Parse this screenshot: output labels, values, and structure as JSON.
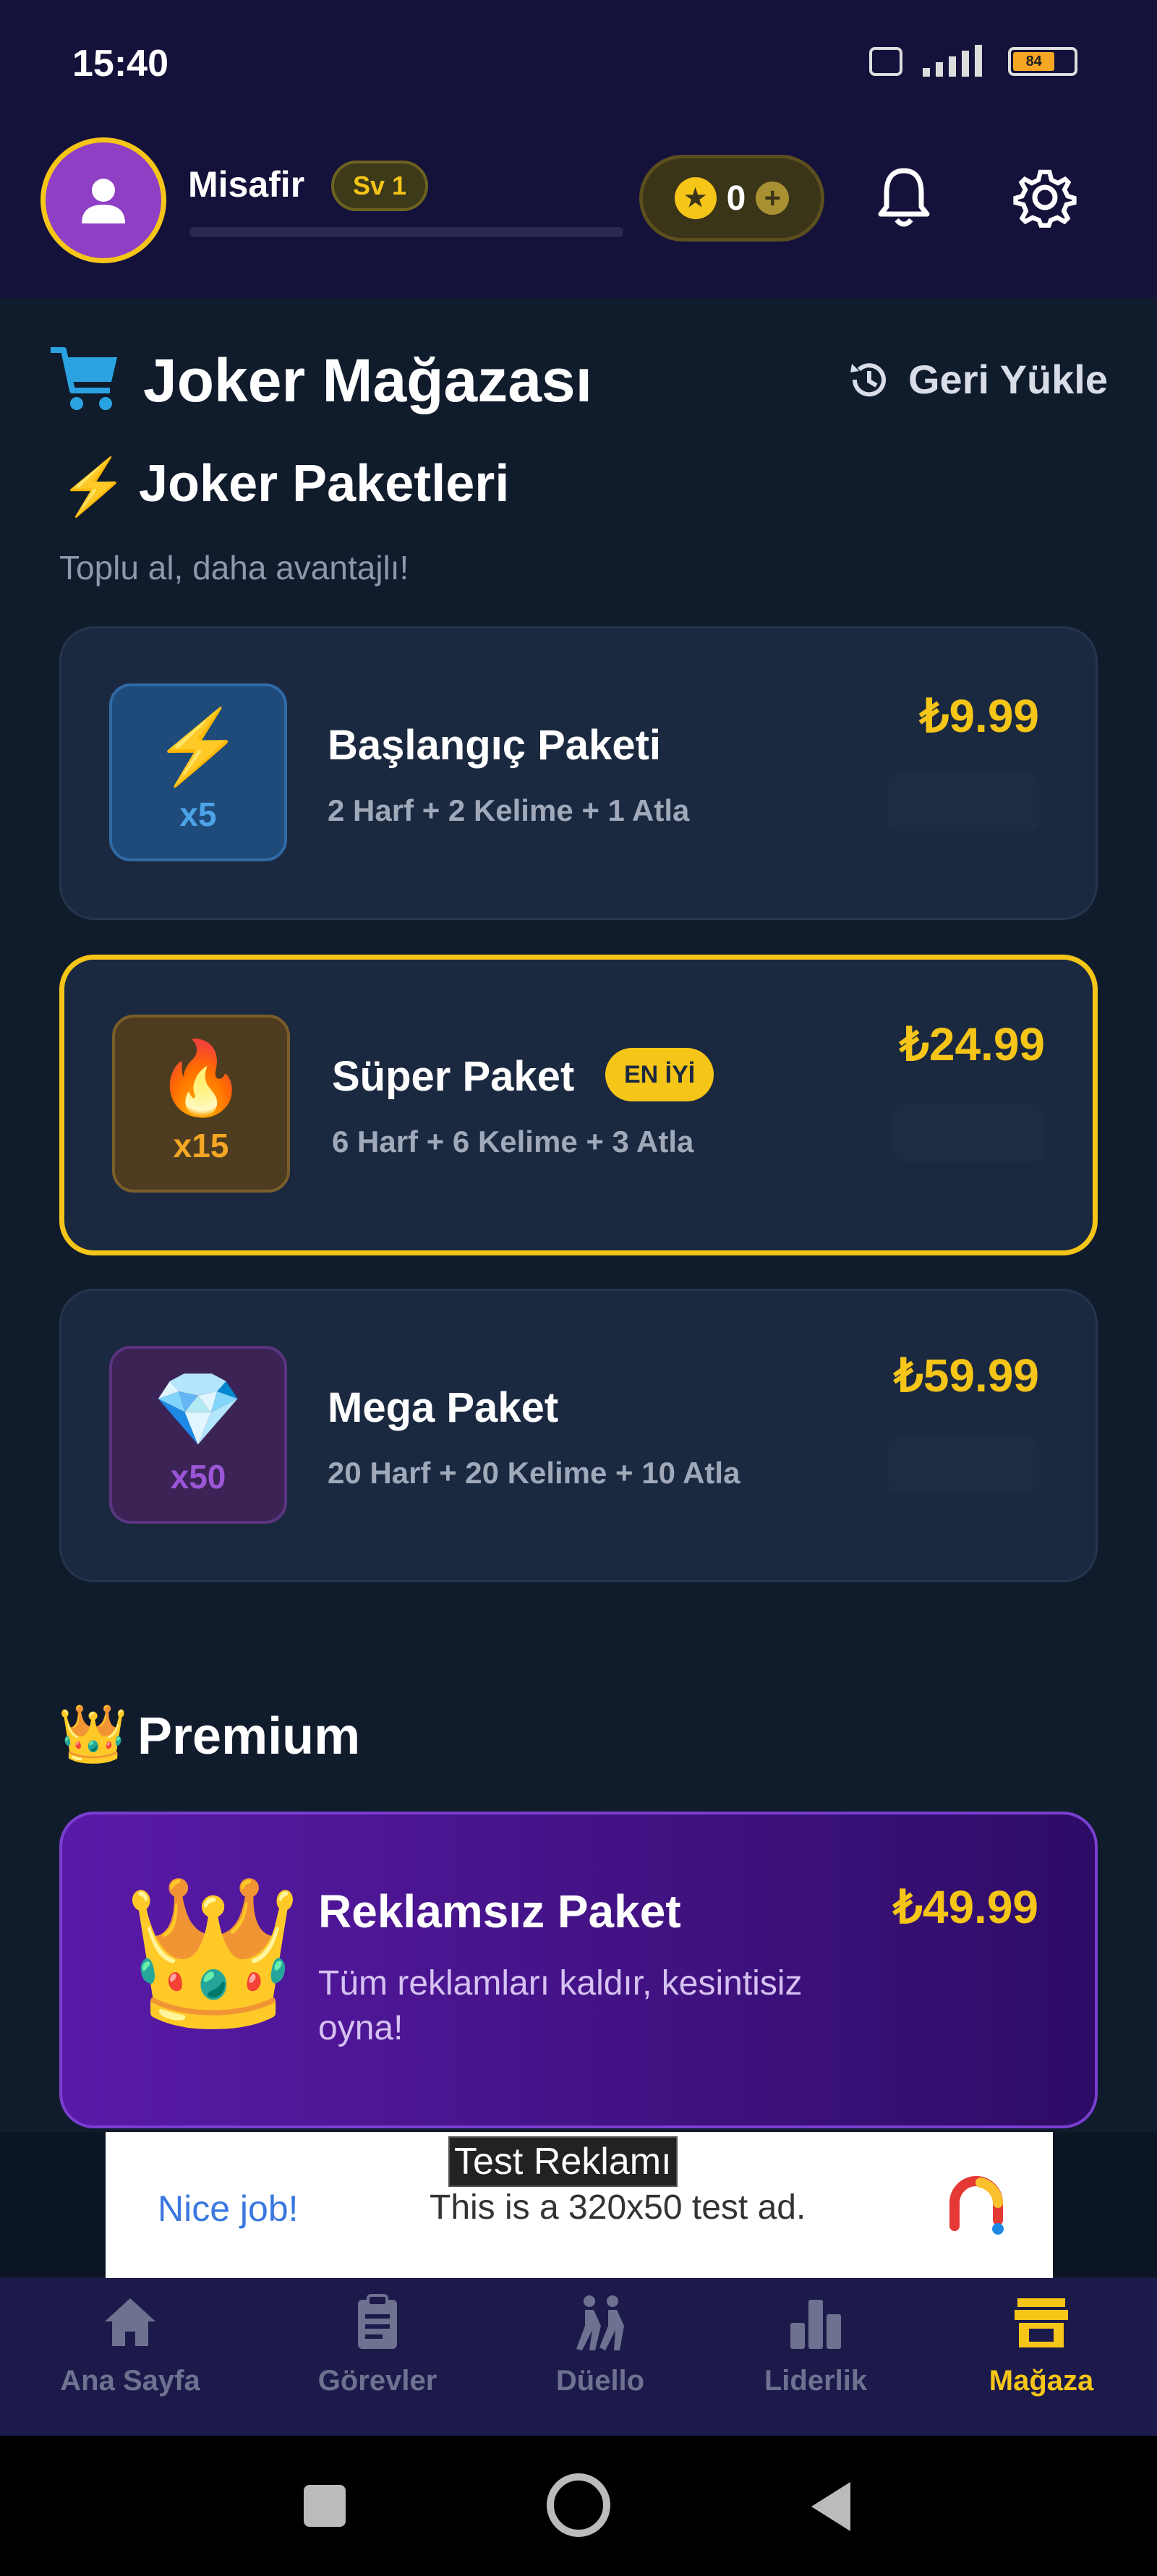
{
  "status_bar": {
    "time": "15:40",
    "battery": "84"
  },
  "header": {
    "username": "Misafir",
    "level": "Sv 1",
    "xp_progress": 0,
    "coins": "0",
    "plus_symbol": "+"
  },
  "store": {
    "title": "Joker Mağazası",
    "restore_label": "Geri Yükle"
  },
  "packs_section": {
    "title": "Joker Paketleri",
    "hint": "Toplu al, daha avantajlı!",
    "packs": [
      {
        "icon": "⚡",
        "multiplier": "x5",
        "name": "Başlangıç Paketi",
        "contents": "2 Harf + 2 Kelime + 1 Atla",
        "price": "₺9.99"
      },
      {
        "icon": "🔥",
        "multiplier": "x15",
        "name": "Süper Paket",
        "badge": "EN İYİ",
        "contents": "6 Harf + 6 Kelime + 3 Atla",
        "price": "₺24.99"
      },
      {
        "icon": "💎",
        "multiplier": "x50",
        "name": "Mega Paket",
        "contents": "20 Harf + 20 Kelime + 10 Atla",
        "price": "₺59.99"
      }
    ]
  },
  "premium": {
    "title": "Premium",
    "crown": "👑",
    "pack_name": "Reklamsız Paket",
    "description": "Tüm reklamları kaldır, kesintisiz oyna!",
    "price": "₺49.99"
  },
  "ad": {
    "label": "Test Reklamı",
    "nice": "Nice job!",
    "text": "This is a 320x50 test ad."
  },
  "nav": {
    "items": [
      {
        "label": "Ana Sayfa",
        "icon": "home-icon"
      },
      {
        "label": "Görevler",
        "icon": "clipboard-icon"
      },
      {
        "label": "Düello",
        "icon": "duel-icon"
      },
      {
        "label": "Liderlik",
        "icon": "leaderboard-icon"
      },
      {
        "label": "Mağaza",
        "icon": "store-icon",
        "active": true
      }
    ]
  },
  "colors": {
    "accent": "#f5c518",
    "background": "#101b2c",
    "premium": "#5a1aa8"
  }
}
